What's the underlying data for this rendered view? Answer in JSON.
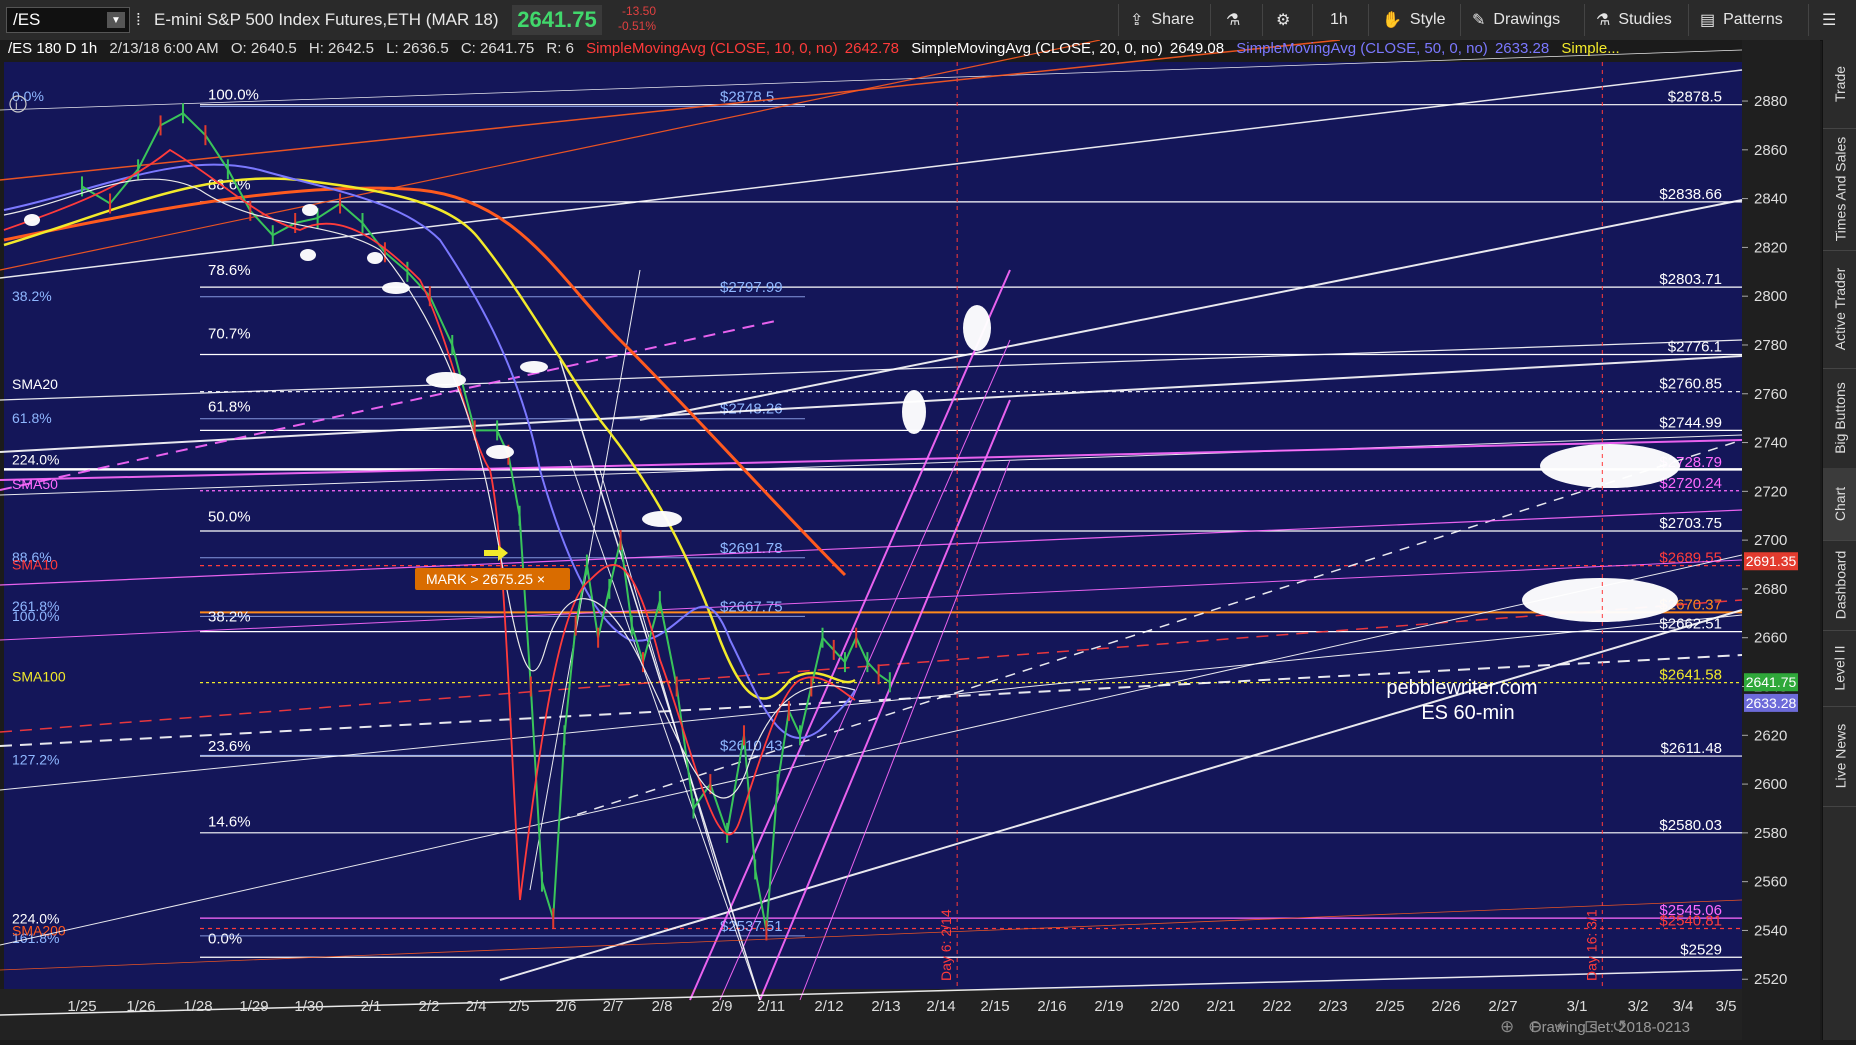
{
  "toolbar": {
    "symbol": "/ES",
    "description": "E-mini S&P 500 Index Futures,ETH (MAR 18)",
    "price": "2641.75",
    "change": "-13.50",
    "change_pct": "-0.51%",
    "share": "Share",
    "interval": "1h",
    "style": "Style",
    "drawings": "Drawings",
    "studies": "Studies",
    "patterns": "Patterns"
  },
  "infobar": {
    "title": "/ES 180 D 1h",
    "date": "2/13/18 6:00 AM",
    "open": "O: 2640.5",
    "high": "H: 2642.5",
    "low": "L: 2636.5",
    "close": "C: 2641.75",
    "range": "R: 6",
    "sma10": "SimpleMovingAvg (CLOSE, 10, 0, no)",
    "sma10_val": "2642.78",
    "sma20": "SimpleMovingAvg (CLOSE, 20, 0, no)",
    "sma20_val": "2649.08",
    "sma50": "SimpleMovingAvg (CLOSE, 50, 0, no)",
    "sma50_val": "2633.28",
    "more": "Simple..."
  },
  "right_tabs": [
    "Trade",
    "Times And Sales",
    "Active Trader",
    "Big Buttons",
    "Chart",
    "Dashboard",
    "Level II",
    "Live News"
  ],
  "footer": {
    "drawing_set": "Drawing set: 2018-0213"
  },
  "watermark": {
    "line1": "pebblewriter.com",
    "line2": "ES 60-min"
  },
  "mark_label": "MARK > 2675.25 ×",
  "colors": {
    "background": "#141659",
    "sma10": "#ff3b3b",
    "sma20": "#e9e9e9",
    "sma50": "#7b78ff",
    "sma100": "#f2ea2b",
    "sma200": "#ff5a1f",
    "magenta": "#ff6bff",
    "fib_blue": "#8fb7ff"
  },
  "chart_data": {
    "type": "line",
    "title": "/ES 180 D 1h",
    "xlabel": "",
    "ylabel": "",
    "ylim": [
      2516,
      2896
    ],
    "x_ticks": [
      "1/25",
      "1/26",
      "1/28",
      "1/29",
      "1/30",
      "2/1",
      "2/2",
      "2/4",
      "2/5",
      "2/6",
      "2/7",
      "2/8",
      "2/9",
      "2/11",
      "2/12",
      "2/13",
      "2/14",
      "2/15",
      "2/16",
      "2/19",
      "2/20",
      "2/21",
      "2/22",
      "2/23",
      "2/25",
      "2/26",
      "2/27",
      "3/1",
      "3/2",
      "3/4",
      "3/5"
    ],
    "y_ticks": [
      2520,
      2540,
      2560,
      2580,
      2600,
      2620,
      2640,
      2660,
      2680,
      2700,
      2720,
      2740,
      2760,
      2780,
      2800,
      2820,
      2840,
      2860,
      2880
    ],
    "price_series": {
      "name": "/ES",
      "x_index": [
        0,
        0.5,
        1,
        1.4,
        1.8,
        2.2,
        2.6,
        3,
        3.4,
        3.8,
        4.2,
        4.6,
        5,
        5.4,
        5.8,
        6.2,
        6.6,
        7,
        7.4,
        7.6,
        7.8,
        8,
        8.2,
        8.4,
        8.6,
        8.8,
        9,
        9.2,
        9.4,
        9.6,
        9.8,
        10,
        10.3,
        10.6,
        10.9,
        11.2,
        11.5,
        11.8,
        12,
        12.2,
        12.4,
        12.6,
        12.8,
        13,
        13.2,
        13.4,
        13.6,
        13.8,
        14,
        14.2,
        14.4
      ],
      "values": [
        2845,
        2838,
        2852,
        2870,
        2875,
        2866,
        2852,
        2835,
        2825,
        2830,
        2832,
        2838,
        2830,
        2818,
        2810,
        2800,
        2780,
        2745,
        2745,
        2735,
        2710,
        2640,
        2560,
        2545,
        2620,
        2665,
        2690,
        2660,
        2680,
        2700,
        2665,
        2650,
        2675,
        2640,
        2590,
        2600,
        2580,
        2620,
        2565,
        2540,
        2600,
        2630,
        2620,
        2640,
        2660,
        2655,
        2650,
        2660,
        2650,
        2645,
        2641.75
      ]
    },
    "price_labels": [
      {
        "label": "$2878.5",
        "value": 2878.5
      },
      {
        "label": "$2838.66",
        "value": 2838.66
      },
      {
        "label": "$2803.71",
        "value": 2803.71
      },
      {
        "label": "$2776.1",
        "value": 2776.1
      },
      {
        "label": "$2760.85",
        "value": 2760.85
      },
      {
        "label": "$2744.99",
        "value": 2744.99
      },
      {
        "label": "$2728.79",
        "value": 2728.79
      },
      {
        "label": "$2720.24",
        "value": 2720.24
      },
      {
        "label": "$2703.75",
        "value": 2703.75
      },
      {
        "label": "$2689.55",
        "value": 2689.55
      },
      {
        "label": "$2670.37",
        "value": 2670.37
      },
      {
        "label": "$2662.51",
        "value": 2662.51
      },
      {
        "label": "$2641.58",
        "value": 2641.58
      },
      {
        "label": "$2611.48",
        "value": 2611.48
      },
      {
        "label": "$2580.03",
        "value": 2580.03
      },
      {
        "label": "$2545.06",
        "value": 2545.06
      },
      {
        "label": "$2540.81",
        "value": 2540.81
      },
      {
        "label": "$2529",
        "value": 2529
      }
    ],
    "axis_badges": [
      {
        "label": "2691.35",
        "value": 2691.35,
        "color": "#e23b2e"
      },
      {
        "label": "2641.75",
        "value": 2641.75,
        "color": "#2fa83a"
      },
      {
        "label": "2633.28",
        "value": 2633.28,
        "color": "#6d6bd9"
      }
    ],
    "fib_left": [
      {
        "label": "0.0%",
        "value": 2882
      },
      {
        "label": "38.2%",
        "value": 2800
      },
      {
        "label": "61.8%",
        "value": 2750
      },
      {
        "label": "224.0%",
        "value": 2733
      },
      {
        "label": "88.6%",
        "value": 2693
      },
      {
        "label": "261.8%",
        "value": 2673
      },
      {
        "label": "100.0%",
        "value": 2669
      },
      {
        "label": "127.2%",
        "value": 2610
      },
      {
        "label": "224.0%",
        "value": 2545
      },
      {
        "label": "161.8%",
        "value": 2537
      }
    ],
    "fib_mid": [
      {
        "label": "100.0%",
        "value": 2879
      },
      {
        "label": "88.6%",
        "value": 2842
      },
      {
        "label": "78.6%",
        "value": 2807
      },
      {
        "label": "70.7%",
        "value": 2781
      },
      {
        "label": "61.8%",
        "value": 2751
      },
      {
        "label": "50.0%",
        "value": 2706
      },
      {
        "label": "38.2%",
        "value": 2665
      },
      {
        "label": "23.6%",
        "value": 2612
      },
      {
        "label": "14.6%",
        "value": 2581
      },
      {
        "label": "0.0%",
        "value": 2533
      }
    ],
    "fib_mid_prices": [
      {
        "label": "$2878.5",
        "value": 2879
      },
      {
        "label": "$2797.99",
        "value": 2801
      },
      {
        "label": "$2748.26",
        "value": 2751
      },
      {
        "label": "$2691.78",
        "value": 2694
      },
      {
        "label": "$2667.75",
        "value": 2670
      },
      {
        "label": "$2610.43",
        "value": 2613
      },
      {
        "label": "$2537.51",
        "value": 2539
      }
    ],
    "sma_labels": [
      {
        "label": "SMA20",
        "value": 2764
      },
      {
        "label": "SMA50",
        "value": 2723
      },
      {
        "label": "SMA10",
        "value": 2690
      },
      {
        "label": "SMA100",
        "value": 2644
      },
      {
        "label": "SMA200",
        "value": 2540
      }
    ],
    "vertical_markers": [
      {
        "label": "Day 6: 2/14",
        "x_index": 15.6
      },
      {
        "label": "Day 16: 3/1",
        "x_index": 27.1
      }
    ],
    "grid": false,
    "legend": "top"
  }
}
